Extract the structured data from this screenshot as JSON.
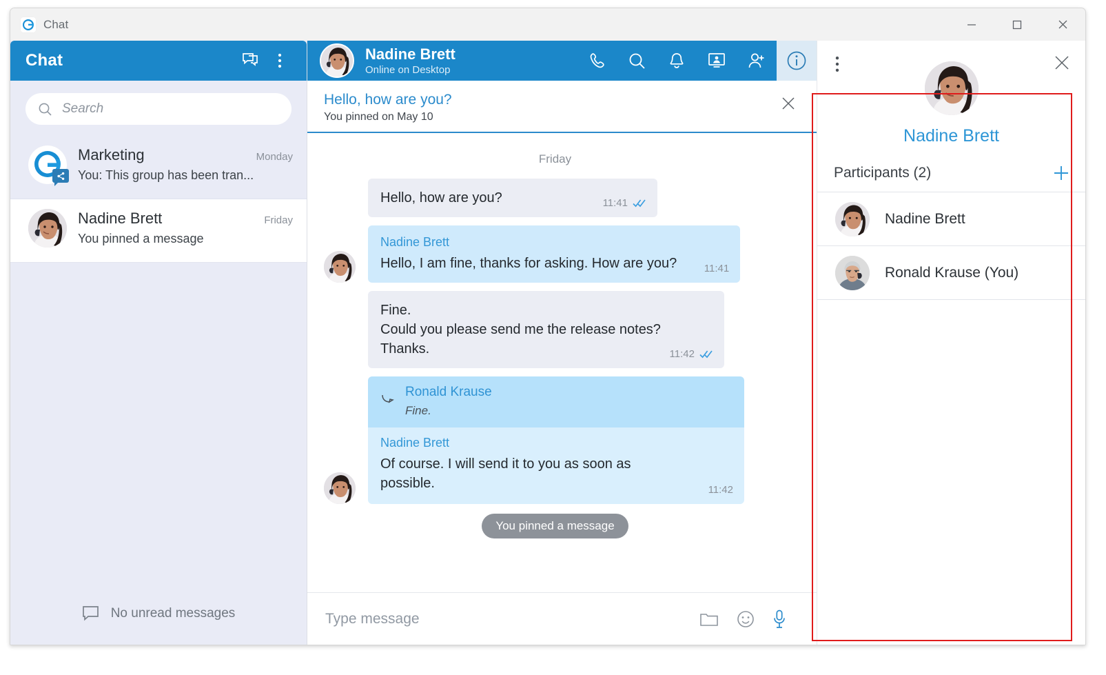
{
  "window": {
    "app_icon": "app-logo-icon",
    "title": "Chat",
    "controls": {
      "minimize": "minimize-icon",
      "maximize": "maximize-icon",
      "close": "close-icon"
    }
  },
  "colors": {
    "header_blue": "#1b87c9",
    "accent_blue": "#2b8bcc",
    "sidebar_bg": "#e9ebf6",
    "bubble_outgoing": "#ebedf4",
    "bubble_incoming": "#cfeafc",
    "quote_bg": "#b6e1fb",
    "annotation_red": "#e01b1b",
    "link_blue": "#3397d6"
  },
  "sidebar": {
    "header": {
      "title": "Chat",
      "new_chat_icon": "new-chat-icon",
      "menu_icon": "more-vertical-icon"
    },
    "search": {
      "placeholder": "Search",
      "value": "",
      "icon": "search-icon"
    },
    "items": [
      {
        "name": "Marketing",
        "time": "Monday",
        "preview": "You: This group has been tran...",
        "avatar": "group-logo-avatar",
        "badge": "share-badge-icon",
        "selected": false
      },
      {
        "name": "Nadine Brett",
        "time": "Friday",
        "preview": "You pinned a message",
        "avatar": "woman-phone-avatar",
        "badge": "",
        "selected": true
      }
    ],
    "footer": {
      "icon": "chat-bubble-icon",
      "text": "No unread messages"
    }
  },
  "main": {
    "header": {
      "avatar": "woman-phone-avatar",
      "name": "Nadine Brett",
      "status": "Online on Desktop",
      "icons": [
        {
          "name": "call-icon",
          "active": false
        },
        {
          "name": "search-icon",
          "active": false
        },
        {
          "name": "bell-icon",
          "active": false
        },
        {
          "name": "screen-share-icon",
          "active": false
        },
        {
          "name": "add-participant-icon",
          "active": false
        },
        {
          "name": "info-icon",
          "active": true
        }
      ]
    },
    "pinned": {
      "title": "Hello, how are you?",
      "subtitle": "You pinned on May 10",
      "close_icon": "close-icon"
    },
    "day_separator": "Friday",
    "messages": [
      {
        "kind": "outgoing",
        "sender": "",
        "lines": [
          "Hello, how are you?"
        ],
        "time": "11:41",
        "receipt": "double-check-icon"
      },
      {
        "kind": "incoming",
        "sender": "Nadine Brett",
        "lines": [
          "Hello, I am fine, thanks for asking. How are you?"
        ],
        "time": "11:41",
        "receipt": ""
      },
      {
        "kind": "outgoing",
        "sender": "",
        "lines": [
          "Fine.",
          "Could you please send me the release notes?",
          "Thanks."
        ],
        "time": "11:42",
        "receipt": "double-check-icon"
      },
      {
        "kind": "incoming-reply",
        "quote": {
          "name": "Ronald Krause",
          "text": "Fine.",
          "icon": "reply-arrow-icon"
        },
        "sender": "Nadine Brett",
        "lines": [
          "Of course. I will send it to you as soon as possible."
        ],
        "time": "11:42",
        "receipt": ""
      }
    ],
    "system_pill": "You pinned a message",
    "composer": {
      "placeholder": "Type message",
      "value": "",
      "icons": [
        {
          "name": "folder-icon",
          "accent": false
        },
        {
          "name": "emoji-icon",
          "accent": false
        },
        {
          "name": "microphone-icon",
          "accent": true
        }
      ]
    }
  },
  "info_panel": {
    "menu_icon": "more-vertical-icon",
    "close_icon": "close-icon",
    "avatar": "woman-phone-avatar",
    "name": "Nadine Brett",
    "participants_label": "Participants (2)",
    "add_icon": "plus-icon",
    "participants": [
      {
        "name": "Nadine Brett",
        "avatar": "woman-phone-avatar"
      },
      {
        "name": "Ronald Krause (You)",
        "avatar": "man-phone-avatar"
      }
    ]
  }
}
